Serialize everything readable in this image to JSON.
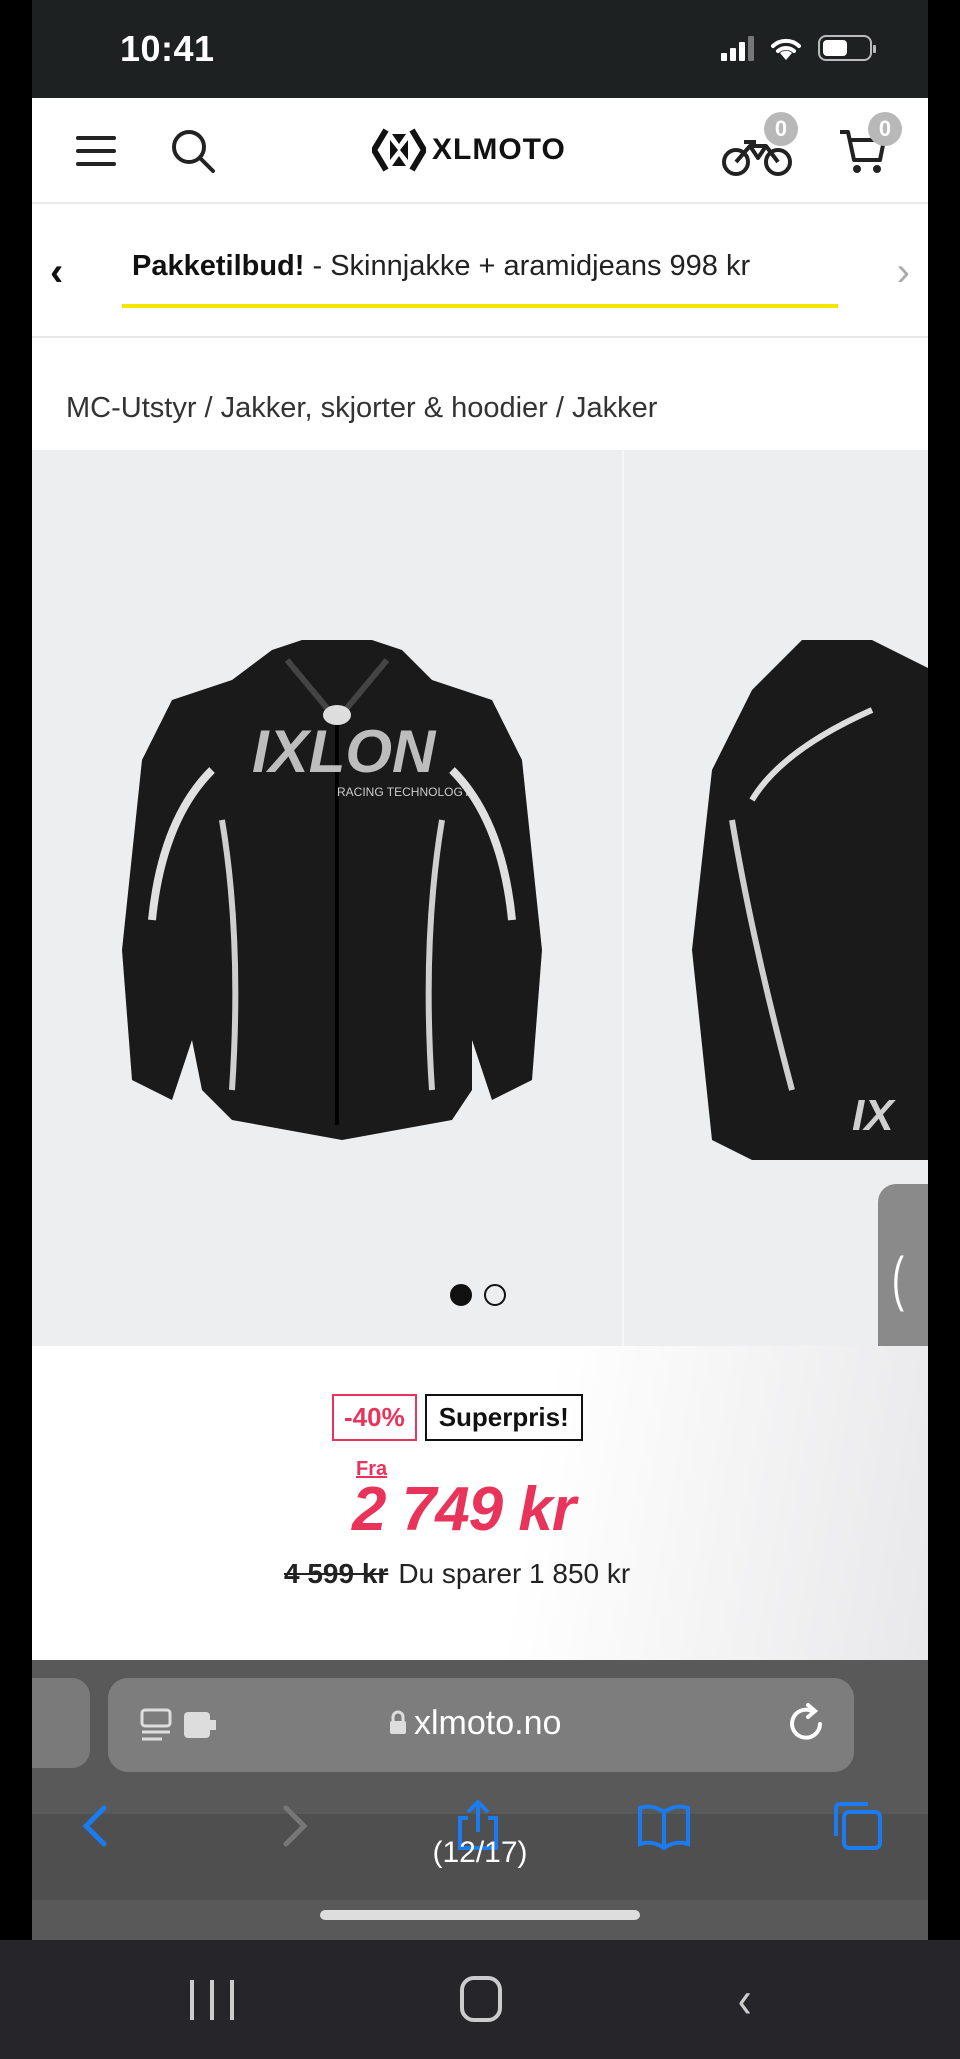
{
  "status_bar": {
    "time": "10:41"
  },
  "header": {
    "logo_text": "XLMOTO",
    "garage_count": "0",
    "cart_count": "0"
  },
  "promo": {
    "bold": "Pakketilbud!",
    "text": " - Skinnjakke + aramidjeans 998 kr",
    "underline_color": "#f3e600"
  },
  "breadcrumb": "MC-Utstyr / Jakker, skjorter & hoodier / Jakker",
  "gallery": {
    "image_count": 2,
    "active_index": 0,
    "side_tab_icon": "chevron-left-icon"
  },
  "pricing": {
    "discount_badge": "-40%",
    "label_badge": "Superpris!",
    "from_label": "Fra",
    "price": "2 749 kr",
    "old_price": "4 599 kr",
    "savings": "Du sparer 1 850 kr",
    "accent_color": "#e8345a"
  },
  "browser": {
    "url": "xlmoto.no",
    "counter": "(12/17)",
    "icon_color": "#1a7cf0"
  }
}
